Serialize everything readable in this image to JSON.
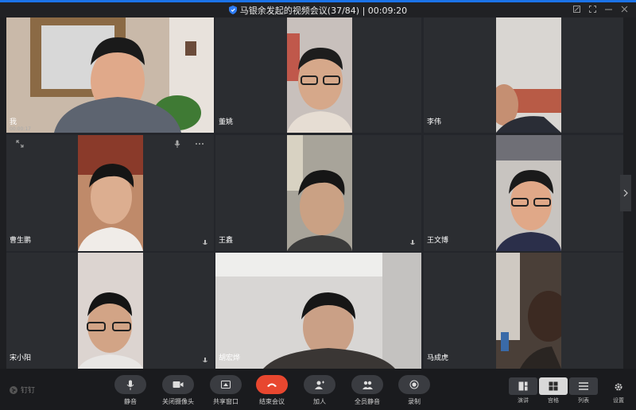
{
  "window": {
    "title": "马银余发起的视频会议(37/84) | 00:09:20",
    "colors": {
      "accent": "#1b73e8",
      "end_button": "#e8472f"
    }
  },
  "participants": [
    {
      "name": "我",
      "sub": "00:00:17",
      "speaking": true
    },
    {
      "name": "董姚"
    },
    {
      "name": "李伟"
    },
    {
      "name": "曹生鹏",
      "muted": true
    },
    {
      "name": "王鑫",
      "muted": true
    },
    {
      "name": "王文博"
    },
    {
      "name": "宋小阳",
      "muted": true
    },
    {
      "name": "胡宏烨"
    },
    {
      "name": "马成虎"
    }
  ],
  "toolbar": {
    "brand": "钉钉",
    "mute": "静音",
    "camera": "关闭摄像头",
    "share": "共享窗口",
    "end": "结束会议",
    "invite": "加人",
    "mute_all": "全员静音",
    "record": "录制"
  },
  "views": {
    "speaker": "演讲",
    "grid": "宫格",
    "list": "列表",
    "settings": "设置"
  },
  "icons": [
    "shield-icon",
    "pin-icon",
    "fullscreen-icon",
    "minimize-icon",
    "close-icon",
    "mic-icon",
    "camera-icon",
    "share-icon",
    "phone-icon",
    "add-user-icon",
    "mute-all-icon",
    "record-icon",
    "speaker-view-icon",
    "grid-view-icon",
    "list-view-icon",
    "gear-icon",
    "expand-icon",
    "more-icon",
    "chevron-right-icon"
  ]
}
